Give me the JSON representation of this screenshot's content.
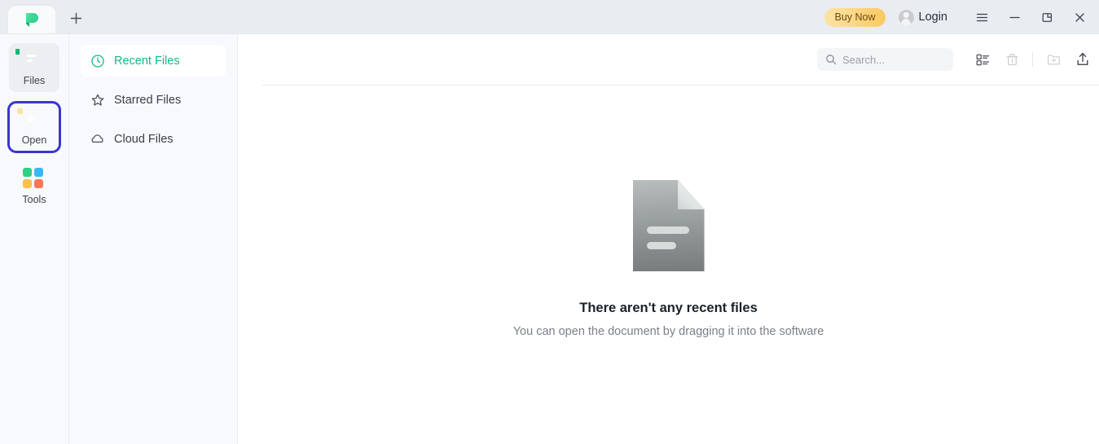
{
  "window": {
    "tab_logo_icon": "app-logo-green-p",
    "new_tab_label": "+",
    "buy_now_label": "Buy Now",
    "login_label": "Login",
    "menu_icon": "hamburger-menu-icon",
    "minimize_icon": "minimize-icon",
    "restore_icon": "restore-icon",
    "close_icon": "close-icon",
    "accent_green": "#12b886",
    "focus_blue": "#3b35d0",
    "buy_now_gradient": "#fbc95f"
  },
  "rail": {
    "items": [
      {
        "label": "Files",
        "icon": "files-icon",
        "state": "hover"
      },
      {
        "label": "Open",
        "icon": "open-file-icon",
        "state": "focused"
      },
      {
        "label": "Tools",
        "icon": "tools-grid-icon",
        "state": "normal"
      }
    ]
  },
  "nav": {
    "items": [
      {
        "label": "Recent Files",
        "icon": "clock-icon",
        "selected": true
      },
      {
        "label": "Starred Files",
        "icon": "star-icon",
        "selected": false
      },
      {
        "label": "Cloud Files",
        "icon": "cloud-icon",
        "selected": false
      }
    ]
  },
  "toolbar": {
    "search_placeholder": "Search...",
    "search_value": "",
    "search_icon": "search-icon",
    "list_view_icon": "list-view-icon",
    "delete_icon": "trash-icon",
    "new_folder_icon": "new-folder-icon",
    "upload_icon": "upload-icon"
  },
  "empty_state": {
    "illustration": "empty-document-icon",
    "title": "There aren't any recent files",
    "subtitle": "You can open the document by dragging it into the software"
  }
}
